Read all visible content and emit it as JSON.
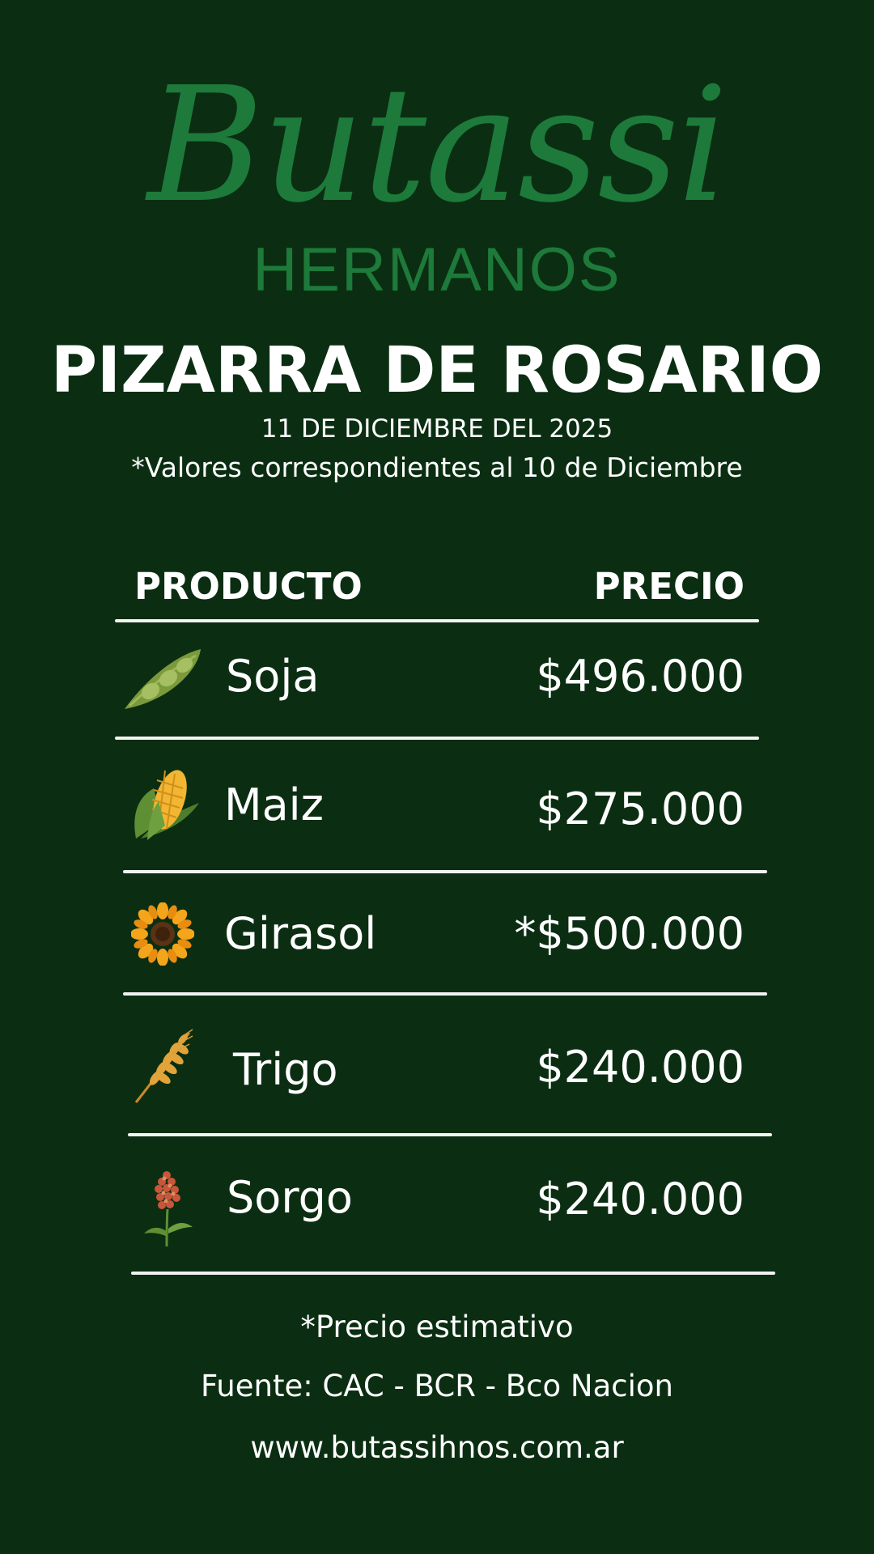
{
  "logo": {
    "brand": "Butassi",
    "sub": "HERMANOS"
  },
  "header": {
    "title": "PIZARRA DE ROSARIO",
    "date": "11 DE DICIEMBRE DEL 2025",
    "note": "*Valores correspondientes al 10 de Diciembre"
  },
  "table": {
    "col_product": "PRODUCTO",
    "col_price": "PRECIO",
    "rows": [
      {
        "name": "Soja",
        "price": "$496.000",
        "icon": "soybean-pod-icon"
      },
      {
        "name": "Maiz",
        "price": "$275.000",
        "icon": "corn-icon"
      },
      {
        "name": "Girasol",
        "price": "*$500.000",
        "icon": "sunflower-icon"
      },
      {
        "name": "Trigo",
        "price": "$240.000",
        "icon": "wheat-icon"
      },
      {
        "name": "Sorgo",
        "price": "$240.000",
        "icon": "sorghum-icon"
      }
    ]
  },
  "footer": {
    "estimate_note": "*Precio estimativo",
    "source": "Fuente: CAC - BCR - Bco Nacion",
    "website": "www.butassihnos.com.ar"
  },
  "colors": {
    "background": "#0b2e12",
    "logo_green": "#1d7a3a",
    "text": "#ffffff"
  }
}
